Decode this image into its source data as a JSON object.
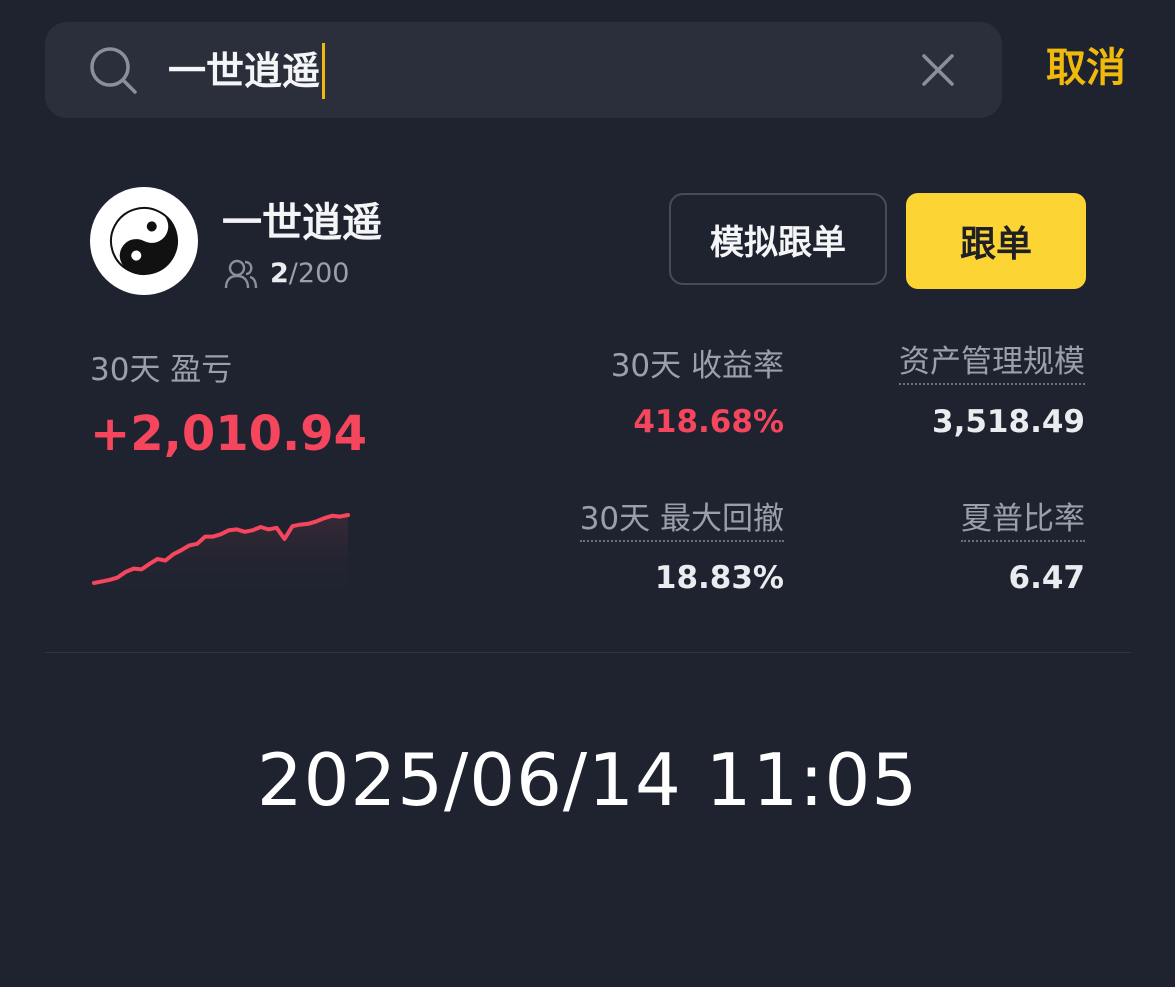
{
  "search": {
    "query": "一世逍遥",
    "cancel_label": "取消"
  },
  "trader": {
    "name": "一世逍遥",
    "avatar_icon": "yin-yang-icon",
    "followers_current": "2",
    "followers_max": "/200",
    "simulate_button": "模拟跟单",
    "follow_button": "跟单"
  },
  "stats": {
    "pnl_label": "30天 盈亏",
    "pnl_value": "+2,010.94",
    "roi_label": "30天  收益率",
    "roi_value": "418.68%",
    "aum_label": "资产管理规模",
    "aum_value": "3,518.49",
    "mdd_label": "30天 最大回撤",
    "mdd_value": "18.83%",
    "sharpe_label": "夏普比率",
    "sharpe_value": "6.47"
  },
  "colors": {
    "accent": "#f0b90b",
    "follow_button": "#fcd535",
    "negative_red": "#f6465d",
    "background": "#1f2330"
  },
  "sparkline_trend": [
    0,
    2,
    4,
    7,
    14,
    18,
    17,
    24,
    30,
    28,
    36,
    41,
    47,
    49,
    58,
    58,
    61,
    66,
    67,
    64,
    66,
    70,
    67,
    69,
    55,
    71,
    73,
    74,
    77,
    81,
    84,
    83,
    85
  ],
  "timestamp": "2025/06/14 11:05"
}
